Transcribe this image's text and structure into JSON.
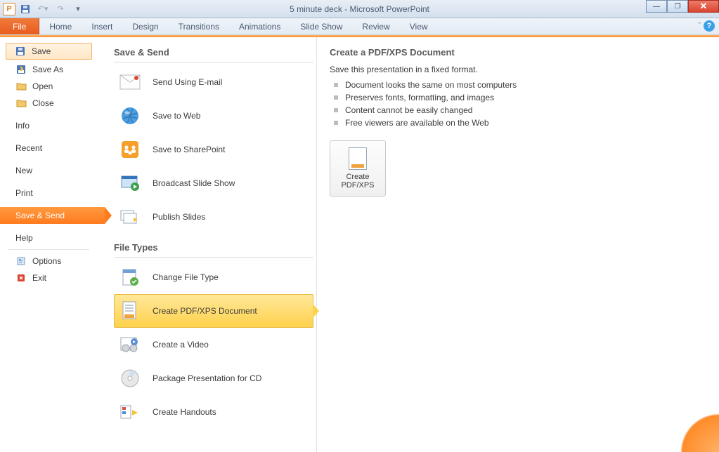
{
  "window": {
    "title": "5 minute deck - Microsoft PowerPoint",
    "app_letter": "P"
  },
  "ribbon": {
    "file": "File",
    "tabs": [
      "Home",
      "Insert",
      "Design",
      "Transitions",
      "Animations",
      "Slide Show",
      "Review",
      "View"
    ]
  },
  "backstage_nav": {
    "save": "Save",
    "save_as": "Save As",
    "open": "Open",
    "close": "Close",
    "info": "Info",
    "recent": "Recent",
    "new": "New",
    "print": "Print",
    "save_send": "Save & Send",
    "help": "Help",
    "options": "Options",
    "exit": "Exit"
  },
  "save_send": {
    "heading": "Save & Send",
    "items": {
      "email": "Send Using E-mail",
      "web": "Save to Web",
      "sharepoint": "Save to SharePoint",
      "broadcast": "Broadcast Slide Show",
      "publish": "Publish Slides"
    },
    "file_types_heading": "File Types",
    "file_types": {
      "change": "Change File Type",
      "pdf": "Create PDF/XPS Document",
      "video": "Create a Video",
      "cd": "Package Presentation for CD",
      "handouts": "Create Handouts"
    }
  },
  "detail": {
    "heading": "Create a PDF/XPS Document",
    "intro": "Save this presentation in a fixed format.",
    "bullets": [
      "Document looks the same on most computers",
      "Preserves fonts, formatting, and images",
      "Content cannot be easily changed",
      "Free viewers are available on the Web"
    ],
    "button_line1": "Create",
    "button_line2": "PDF/XPS"
  }
}
